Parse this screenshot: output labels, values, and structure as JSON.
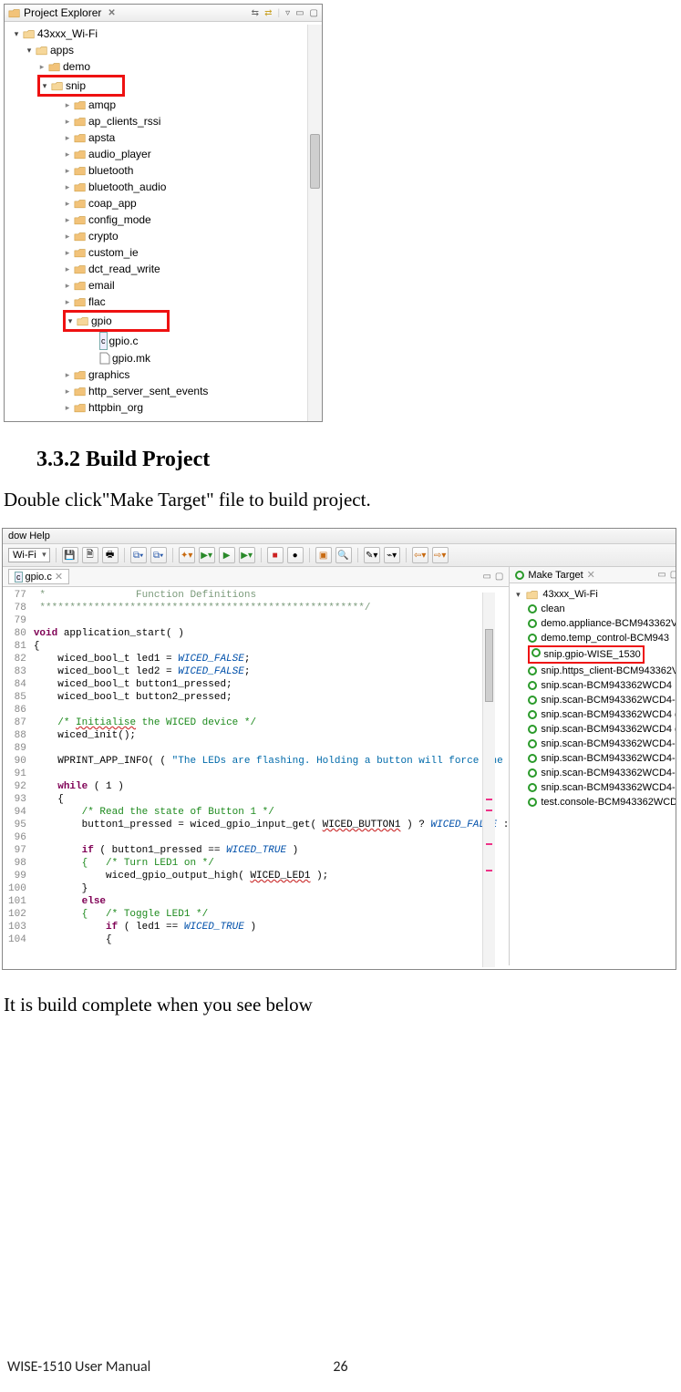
{
  "explorer": {
    "title": "Project Explorer",
    "root": "43xxx_Wi-Fi",
    "apps": "apps",
    "demo": "demo",
    "snip": "snip",
    "snip_children": [
      "amqp",
      "ap_clients_rssi",
      "apsta",
      "audio_player",
      "bluetooth",
      "bluetooth_audio",
      "coap_app",
      "config_mode",
      "crypto",
      "custom_ie",
      "dct_read_write",
      "email",
      "flac"
    ],
    "gpio": "gpio",
    "gpio_files": [
      "gpio.c",
      "gpio.mk"
    ],
    "after_gpio": [
      "graphics",
      "http_server_sent_events",
      "httpbin_org"
    ]
  },
  "section": {
    "heading": "3.3.2 Build Project",
    "p1": "Double click\"Make Target\" file to build project.",
    "p2": "It is build complete when you see below"
  },
  "ide": {
    "menubar": "dow    Help",
    "combo": "Wi-Fi",
    "editor_tab": "gpio.c",
    "target_tab": "Make Target",
    "target_root": "43xxx_Wi-Fi",
    "targets": [
      "clean",
      "demo.appliance-BCM943362V",
      "demo.temp_control-BCM943",
      "snip.gpio-WISE_1530",
      "snip.https_client-BCM943362V",
      "snip.scan-BCM943362WCD4",
      "snip.scan-BCM943362WCD4-",
      "snip.scan-BCM943362WCD4 d",
      "snip.scan-BCM943362WCD4 d",
      "snip.scan-BCM943362WCD4-",
      "snip.scan-BCM943362WCD4-",
      "snip.scan-BCM943362WCD4-",
      "snip.scan-BCM943362WCD4-",
      "test.console-BCM943362WCD"
    ],
    "target_highlight_index": 3,
    "code_lines": [
      {
        "n": 77,
        "t": " *               Function Definitions",
        "cls": "cmtblock"
      },
      {
        "n": 78,
        "t": " ******************************************************/",
        "cls": "cmtblock"
      },
      {
        "n": 79,
        "t": "",
        "cls": ""
      },
      {
        "n": 80,
        "t": "void application_start( )",
        "cls": "kwline"
      },
      {
        "n": 81,
        "t": "{",
        "cls": ""
      },
      {
        "n": 82,
        "t": "    wiced_bool_t led1 = WICED_FALSE;",
        "cls": "decl"
      },
      {
        "n": 83,
        "t": "    wiced_bool_t led2 = WICED_FALSE;",
        "cls": "decl"
      },
      {
        "n": 84,
        "t": "    wiced_bool_t button1_pressed;",
        "cls": "decl2"
      },
      {
        "n": 85,
        "t": "    wiced_bool_t button2_pressed;",
        "cls": "decl2"
      },
      {
        "n": 86,
        "t": "",
        "cls": ""
      },
      {
        "n": 87,
        "t": "    /* Initialise the WICED device */",
        "cls": "cmt ul1"
      },
      {
        "n": 88,
        "t": "    wiced_init();",
        "cls": ""
      },
      {
        "n": 89,
        "t": "",
        "cls": ""
      },
      {
        "n": 90,
        "t": "    WPRINT_APP_INFO( ( \"The LEDs are flashing. Holding a button will force the",
        "cls": "pr"
      },
      {
        "n": 91,
        "t": "",
        "cls": ""
      },
      {
        "n": 92,
        "t": "    while ( 1 )",
        "cls": "kwline"
      },
      {
        "n": 93,
        "t": "    {",
        "cls": ""
      },
      {
        "n": 94,
        "t": "        /* Read the state of Button 1 */",
        "cls": "cmt"
      },
      {
        "n": 95,
        "t": "        button1_pressed = wiced_gpio_input_get( WICED_BUTTON1 ) ? WICED_FALSE :",
        "cls": "ul2"
      },
      {
        "n": 96,
        "t": "",
        "cls": ""
      },
      {
        "n": 97,
        "t": "        if ( button1_pressed == WICED_TRUE )",
        "cls": "kwline"
      },
      {
        "n": 98,
        "t": "        {   /* Turn LED1 on */",
        "cls": "cmt"
      },
      {
        "n": 99,
        "t": "            wiced_gpio_output_high( WICED_LED1 );",
        "cls": "ul2"
      },
      {
        "n": 100,
        "t": "        }",
        "cls": ""
      },
      {
        "n": 101,
        "t": "        else",
        "cls": "kwline"
      },
      {
        "n": 102,
        "t": "        {   /* Toggle LED1 */",
        "cls": "cmt"
      },
      {
        "n": 103,
        "t": "            if ( led1 == WICED_TRUE )",
        "cls": "kwline"
      },
      {
        "n": 104,
        "t": "            {",
        "cls": ""
      }
    ]
  },
  "footer": {
    "doc": "WISE-1510 User Manual",
    "page": "26"
  }
}
